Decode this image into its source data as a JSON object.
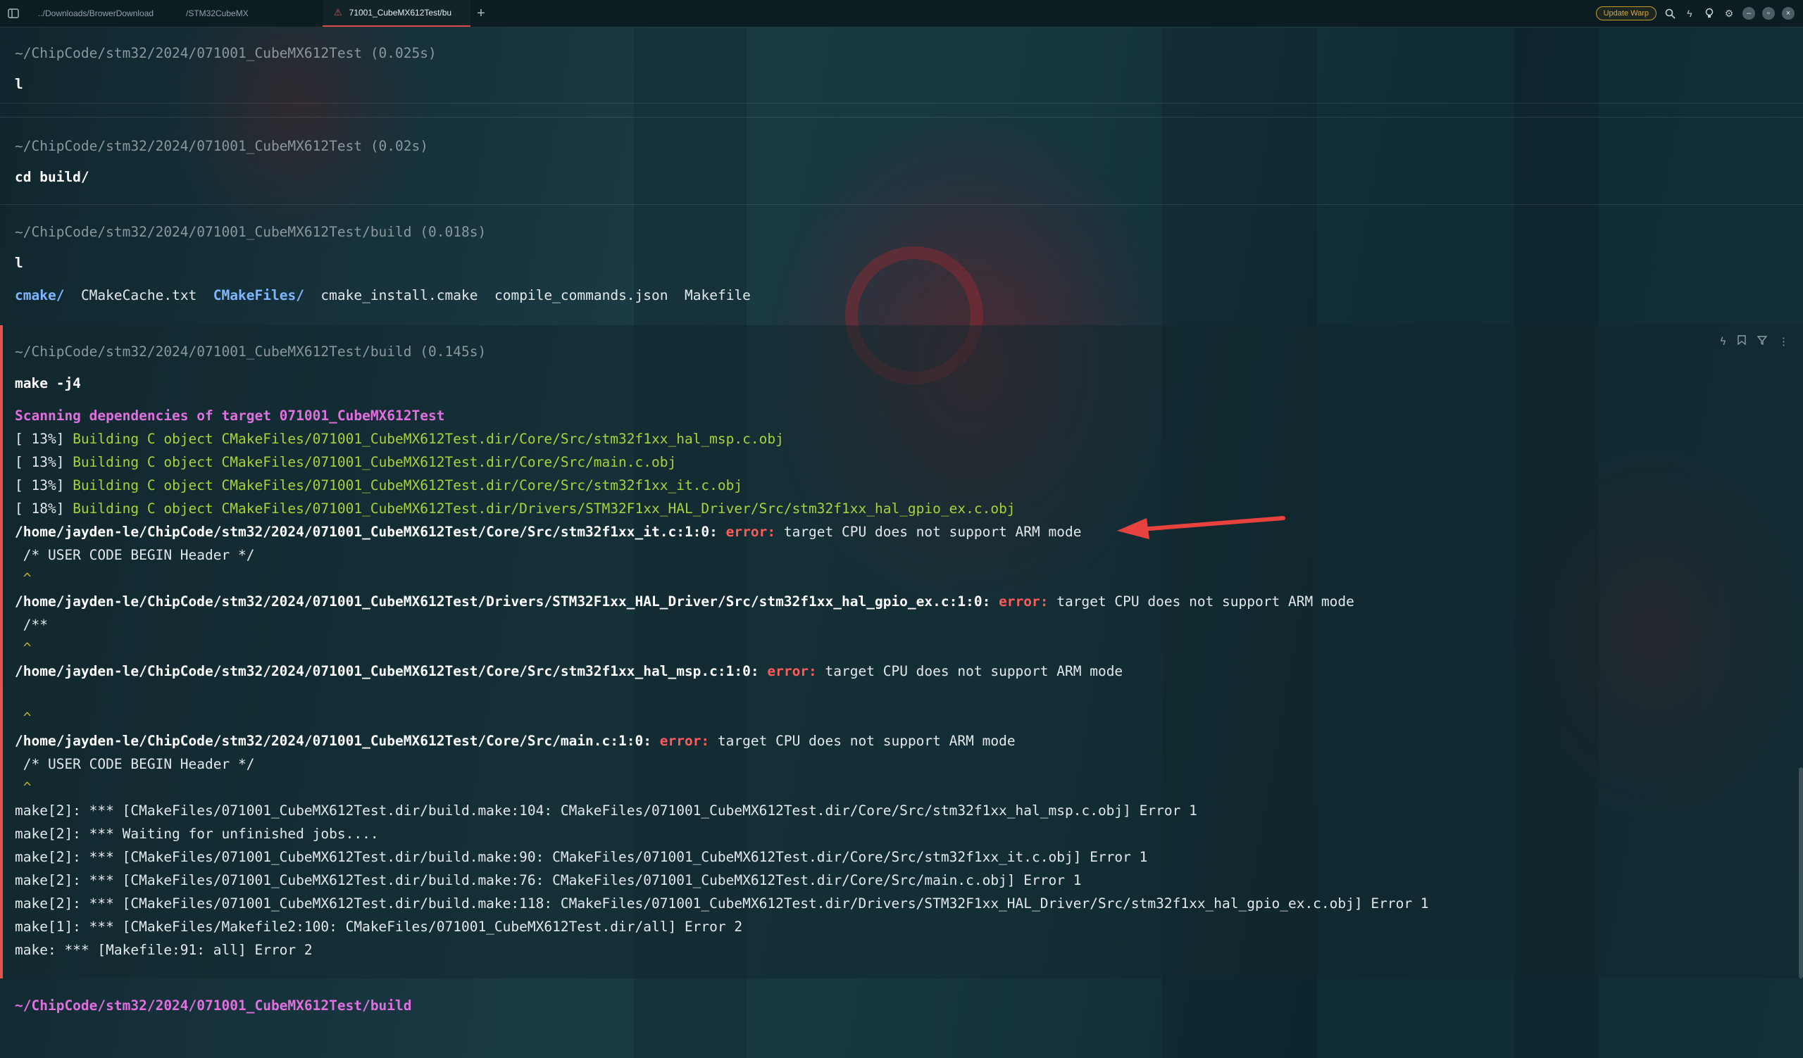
{
  "tabs": [
    {
      "label": "../Downloads/BrowerDownload",
      "active": false
    },
    {
      "label": "/STM32CubeMX",
      "active": false
    },
    {
      "label": "71001_CubeMX612Test/bu",
      "active": true,
      "warning": true
    }
  ],
  "topbar": {
    "update_label": "Update Warp"
  },
  "blocks": [
    {
      "prompt": "~/ChipCode/stm32/2024/071001_CubeMX612Test (0.025s)",
      "command": "l"
    },
    {
      "prompt": "~/ChipCode/stm32/2024/071001_CubeMX612Test (0.02s)",
      "command": "cd build/"
    },
    {
      "prompt": "~/ChipCode/stm32/2024/071001_CubeMX612Test/build (0.018s)",
      "command": "l",
      "listing": [
        "cmake/",
        "CMakeCache.txt",
        "CMakeFiles/",
        "cmake_install.cmake",
        "compile_commands.json",
        "Makefile"
      ]
    }
  ],
  "active": {
    "prompt": "~/ChipCode/stm32/2024/071001_CubeMX612Test/build (0.145s)",
    "command": "make -j4",
    "scanning": "Scanning dependencies of target 071001_CubeMX612Test",
    "building": [
      {
        "pct": "[ 13%] ",
        "text": "Building C object CMakeFiles/071001_CubeMX612Test.dir/Core/Src/stm32f1xx_hal_msp.c.obj"
      },
      {
        "pct": "[ 13%] ",
        "text": "Building C object CMakeFiles/071001_CubeMX612Test.dir/Core/Src/main.c.obj"
      },
      {
        "pct": "[ 13%] ",
        "text": "Building C object CMakeFiles/071001_CubeMX612Test.dir/Core/Src/stm32f1xx_it.c.obj"
      },
      {
        "pct": "[ 18%] ",
        "text": "Building C object CMakeFiles/071001_CubeMX612Test.dir/Drivers/STM32F1xx_HAL_Driver/Src/stm32f1xx_hal_gpio_ex.c.obj"
      }
    ],
    "errors": [
      {
        "path": "/home/jayden-le/ChipCode/stm32/2024/071001_CubeMX612Test/Core/Src/stm32f1xx_it.c:1:0: ",
        "word": "error:",
        "msg": " target CPU does not support ARM mode",
        "ctx": " /* USER CODE BEGIN Header */",
        "caret": " ^"
      },
      {
        "path": "/home/jayden-le/ChipCode/stm32/2024/071001_CubeMX612Test/Drivers/STM32F1xx_HAL_Driver/Src/stm32f1xx_hal_gpio_ex.c:1:0: ",
        "word": "error:",
        "msg": " target CPU does not support ARM mode",
        "ctx": " /**",
        "caret": " ^"
      },
      {
        "path": "/home/jayden-le/ChipCode/stm32/2024/071001_CubeMX612Test/Core/Src/stm32f1xx_hal_msp.c:1:0: ",
        "word": "error:",
        "msg": " target CPU does not support ARM mode",
        "ctx": "",
        "caret": " ^"
      },
      {
        "path": "/home/jayden-le/ChipCode/stm32/2024/071001_CubeMX612Test/Core/Src/main.c:1:0: ",
        "word": "error:",
        "msg": " target CPU does not support ARM mode",
        "ctx": " /* USER CODE BEGIN Header */",
        "caret": " ^"
      }
    ],
    "make_lines": [
      "make[2]: *** [CMakeFiles/071001_CubeMX612Test.dir/build.make:104: CMakeFiles/071001_CubeMX612Test.dir/Core/Src/stm32f1xx_hal_msp.c.obj] Error 1",
      "make[2]: *** Waiting for unfinished jobs....",
      "make[2]: *** [CMakeFiles/071001_CubeMX612Test.dir/build.make:90: CMakeFiles/071001_CubeMX612Test.dir/Core/Src/stm32f1xx_it.c.obj] Error 1",
      "make[2]: *** [CMakeFiles/071001_CubeMX612Test.dir/build.make:76: CMakeFiles/071001_CubeMX612Test.dir/Core/Src/main.c.obj] Error 1",
      "make[2]: *** [CMakeFiles/071001_CubeMX612Test.dir/build.make:118: CMakeFiles/071001_CubeMX612Test.dir/Drivers/STM32F1xx_HAL_Driver/Src/stm32f1xx_hal_gpio_ex.c.obj] Error 1",
      "make[1]: *** [CMakeFiles/Makefile2:100: CMakeFiles/071001_CubeMX612Test.dir/all] Error 2",
      "make: *** [Makefile:91: all] Error 2"
    ]
  },
  "current_prompt": "~/ChipCode/stm32/2024/071001_CubeMX612Test/build",
  "colors": {
    "accent_red": "#e0554e",
    "error": "#ff5b5b",
    "build_green": "#a7d23a",
    "scan_magenta": "#e070e0",
    "dir_blue": "#7fb6ff"
  },
  "icons": [
    "sidebar-icon",
    "warning-icon",
    "plus-icon",
    "search-icon",
    "bolt-icon",
    "lightbulb-icon",
    "gear-icon",
    "minimize-icon",
    "maximize-icon",
    "close-icon",
    "share-icon",
    "bookmark-icon",
    "filter-icon",
    "more-icon"
  ]
}
